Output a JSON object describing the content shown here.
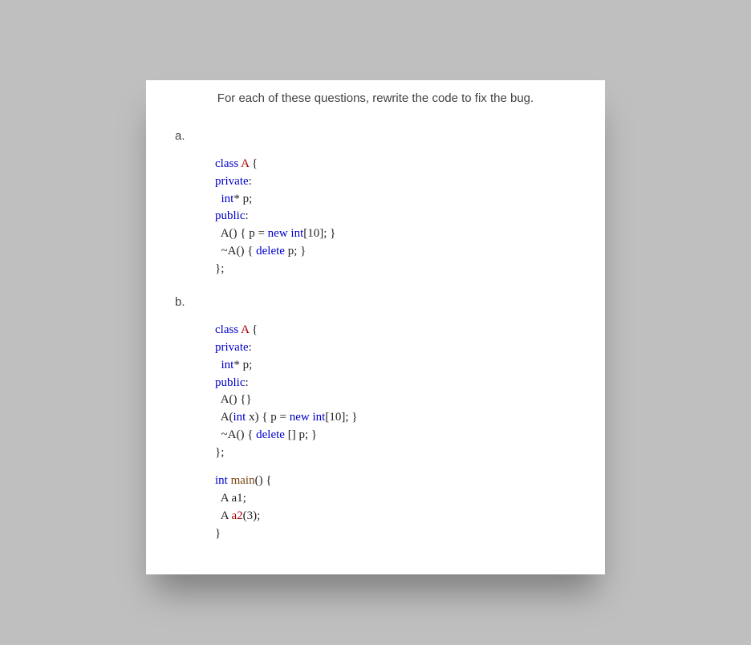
{
  "title": "For each of these questions, rewrite the code to fix the bug.",
  "question_a": {
    "label": "a.",
    "code": {
      "l1_class": "class",
      "l1_name": " A",
      "l1_brace": " {",
      "l2_private": "private",
      "l2_colon": ":",
      "l3_indent": "  ",
      "l3_int": "int",
      "l3_rest": "* p;",
      "l4_public": "public",
      "l4_colon": ":",
      "l5_indent": "  ",
      "l5_ctor": "A() { p = ",
      "l5_new": "new",
      "l5_rest": " ",
      "l5_int": "int",
      "l5_close": "[10]; }",
      "l6_indent": "  ",
      "l6_dtor": "~A() { ",
      "l6_delete": "delete",
      "l6_rest": " p; }",
      "l7": "};"
    }
  },
  "question_b": {
    "label": "b.",
    "code": {
      "l1_class": "class",
      "l1_name": " A",
      "l1_brace": " {",
      "l2_private": "private",
      "l2_colon": ":",
      "l3_indent": "  ",
      "l3_int": "int",
      "l3_rest": "* p;",
      "l4_public": "public",
      "l4_colon": ":",
      "l5_indent": "  ",
      "l5_ctor": "A() {}",
      "l6_indent": "  ",
      "l6_ctor_a": "A(",
      "l6_int": "int",
      "l6_ctor_b": " x) { p = ",
      "l6_new": "new",
      "l6_ctor_c": " ",
      "l6_int2": "int",
      "l6_close": "[10]; }",
      "l7_indent": "  ",
      "l7_dtor": "~A() { ",
      "l7_delete": "delete",
      "l7_rest": " [] p; }",
      "l8": "};",
      "m1_int": "int",
      "m1_main": " main",
      "m1_rest": "() {",
      "m2_indent": "  ",
      "m2": "A a1;",
      "m3_indent": "  ",
      "m3_a": "A ",
      "m3_var": "a2",
      "m3_rest": "(3);",
      "m4": "}"
    }
  }
}
